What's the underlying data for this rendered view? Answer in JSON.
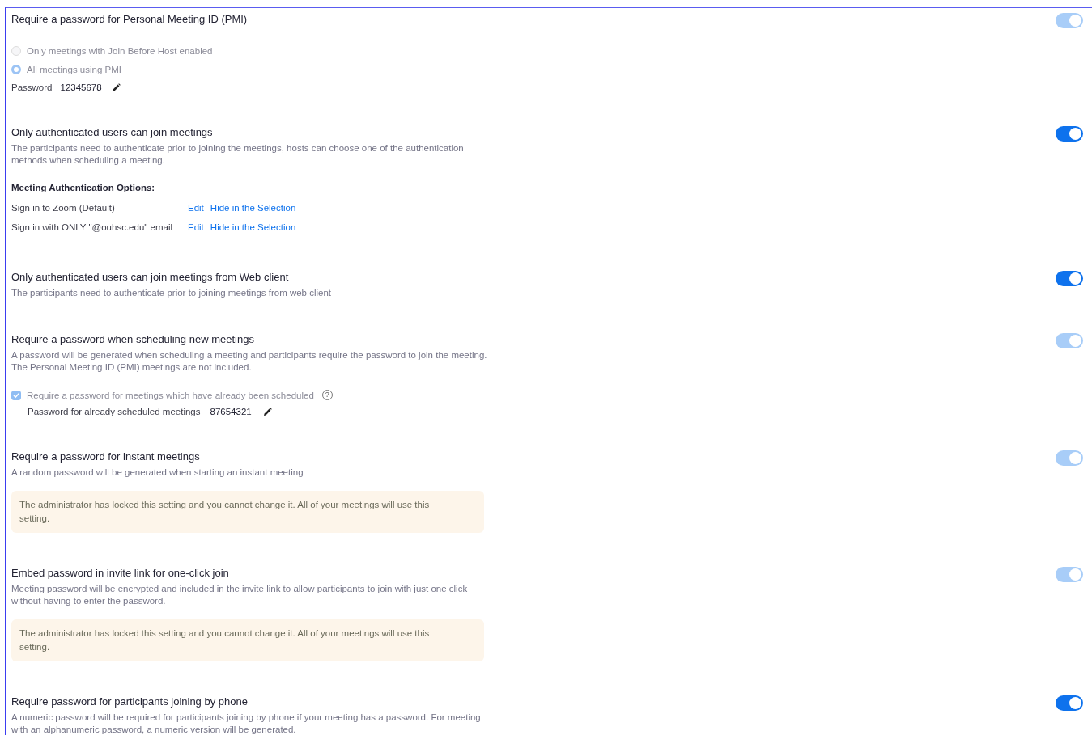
{
  "settings": [
    {
      "title": "Require a password for Personal Meeting ID (PMI)",
      "toggle": {
        "on": true,
        "disabled": true
      },
      "blocks": [
        {
          "kind": "radios",
          "options": [
            {
              "label": "Only meetings with Join Before Host enabled",
              "selected": false
            },
            {
              "label": "All meetings using PMI",
              "selected": true
            }
          ]
        },
        {
          "kind": "password",
          "label": "Password",
          "value": "12345678"
        }
      ]
    },
    {
      "title": "Only authenticated users can join meetings",
      "description": "The participants need to authenticate prior to joining the meetings, hosts can choose one of the authentication methods when scheduling a meeting.",
      "toggle": {
        "on": true,
        "disabled": false
      },
      "blocks": [
        {
          "kind": "auth_options",
          "heading": "Meeting Authentication Options:",
          "rows": [
            {
              "label": "Sign in to Zoom (Default)",
              "edit": "Edit",
              "hide": "Hide in the Selection"
            },
            {
              "label": "Sign in with ONLY \"@ouhsc.edu\" email",
              "edit": "Edit",
              "hide": "Hide in the Selection"
            }
          ]
        }
      ]
    },
    {
      "title": "Only authenticated users can join meetings from Web client",
      "description": "The participants need to authenticate prior to joining meetings from web client",
      "toggle": {
        "on": true,
        "disabled": false
      }
    },
    {
      "title": "Require a password when scheduling new meetings",
      "description": "A password will be generated when scheduling a meeting and participants require the password to join the meeting. The Personal Meeting ID (PMI) meetings are not included.",
      "toggle": {
        "on": true,
        "disabled": true
      },
      "blocks": [
        {
          "kind": "checkbox",
          "label": "Require a password for meetings which have already been scheduled",
          "checked": true,
          "help": "?"
        },
        {
          "kind": "password",
          "indent": true,
          "label": "Password for already scheduled meetings",
          "value": "87654321"
        }
      ]
    },
    {
      "title": "Require a password for instant meetings",
      "description": "A random password will be generated when starting an instant meeting",
      "toggle": {
        "on": true,
        "disabled": true
      },
      "blocks": [
        {
          "kind": "notice",
          "text": "The administrator has locked this setting and you cannot change it. All of your meetings will use this setting."
        }
      ]
    },
    {
      "title": "Embed password in invite link for one-click join",
      "description": "Meeting password will be encrypted and included in the invite link to allow participants to join with just one click without having to enter the password.",
      "toggle": {
        "on": true,
        "disabled": true
      },
      "blocks": [
        {
          "kind": "notice",
          "text": "The administrator has locked this setting and you cannot change it. All of your meetings will use this setting."
        }
      ]
    },
    {
      "title": "Require password for participants joining by phone",
      "description": "A numeric password will be required for participants joining by phone if your meeting has a password. For meeting with an alphanumeric password, a numeric version will be generated.",
      "toggle": {
        "on": true,
        "disabled": false
      }
    }
  ]
}
